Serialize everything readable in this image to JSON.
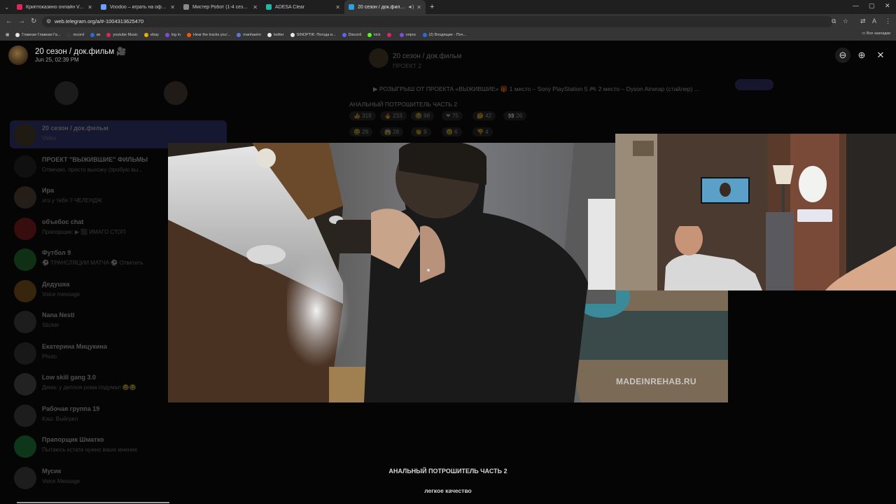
{
  "browser": {
    "tabs": [
      {
        "title": "Криптоказино онлайн VAVADA",
        "color": "#e0245e"
      },
      {
        "title": "Voodoo – играть на официальн...",
        "color": "#6aa0ff"
      },
      {
        "title": "Мистер Робот (1-4 сезон) смо...",
        "color": "#8a8a8a"
      },
      {
        "title": "ADESA Clear",
        "color": "#1fb7a6"
      },
      {
        "title": "20 сезон / док.фильм",
        "color": "#2aa3e0"
      }
    ],
    "url": "web.telegram.org/a/#-1004313625470",
    "bookmarks": [
      {
        "label": "Главная Главная Га...",
        "color": "#e8e8e8"
      },
      {
        "label": "record",
        "color": "#3b3b3b"
      },
      {
        "label": "вк",
        "color": "#2a6cd6"
      },
      {
        "label": "youtube Music",
        "color": "#e0245e"
      },
      {
        "label": "ebay",
        "color": "#e5b000"
      },
      {
        "label": "log in",
        "color": "#7b4de0"
      },
      {
        "label": "Hear the tracks you'...",
        "color": "#ff5500"
      },
      {
        "label": "manhaeim",
        "color": "#5b7bd6"
      },
      {
        "label": "twitter",
        "color": "#e8e8e8"
      },
      {
        "label": "SINOPTIK: Погода в...",
        "color": "#e8e8e8"
      },
      {
        "label": "Discord",
        "color": "#5865f2"
      },
      {
        "label": "kick",
        "color": "#53fc18"
      },
      {
        "label": "",
        "color": "#e0245e"
      },
      {
        "label": "опрос",
        "color": "#7b4de0"
      },
      {
        "label": "(2) Входящие - Поч...",
        "color": "#2a6cd6"
      }
    ],
    "all_bookmarks": "Все закладки"
  },
  "viewer": {
    "title": "20 сезон / док.фильм 🎥",
    "date": "Jun 25, 02:39 PM",
    "caption_title": "АНАЛЬНЫЙ ПОТРОШИТЕЛЬ ЧАСТЬ 2",
    "caption_quality": "легкое качество",
    "watermark": "MADEINREHAB.RU",
    "progress": 0.17
  },
  "background": {
    "chats": [
      {
        "name": "20 сезон / док.фильм",
        "preview": "Video",
        "color": "#5a4a30",
        "selected": true
      },
      {
        "name": "ПРОЕКТ \"ВЫЖИВШИЕ\" ФИЛЬМЫ",
        "preview": "Отвечаю, просто выхожу (пробую вы...",
        "color": "#2a2a2a",
        "selected": false
      },
      {
        "name": "Ира",
        "preview": "это у тебя ? ЧЕЛЕНДЖ",
        "color": "#6a5040",
        "selected": false
      },
      {
        "name": "объебос chat",
        "preview": "Прапорщик: ▶ ⬛ ИМАГО СТОП",
        "color": "#a02020",
        "selected": false
      },
      {
        "name": "Футбол 9",
        "preview": "⚽ ТРАНСЛЯЦИИ МАТЧА ⚽ Ответить",
        "color": "#2a8a3a",
        "selected": false
      },
      {
        "name": "Дедушка",
        "preview": "Voice message",
        "color": "#a06a20",
        "selected": false
      },
      {
        "name": "Nana Nesti",
        "preview": "Sticker",
        "color": "#505050",
        "selected": false
      },
      {
        "name": "Екатерина Мицукина",
        "preview": "Photo",
        "color": "#404040",
        "selected": false
      },
      {
        "name": "Low skill gang 3.0",
        "preview": "Дима: у деплоя рома подумал 😂😂",
        "color": "#606060",
        "selected": false
      },
      {
        "name": "Рабочая группа 19",
        "preview": "Кэш: Выйгрел",
        "color": "#505050",
        "selected": false
      },
      {
        "name": "Прапорщик Шматко",
        "preview": "Пытаюсь кстати нужно ваше мнение",
        "color": "#20a040",
        "selected": false
      },
      {
        "name": "Мусик",
        "preview": "Voice Message",
        "color": "#505050",
        "selected": false
      }
    ],
    "pinned_title": "20 сезон / док.фильм",
    "pinned_sub": "ПРОЕКТ 2",
    "post_text": "▶ РОЗЫГРЫШ ОТ ПРОЕКТА «ВЫЖИВШИЕ» 🎁 1 место – Sony PlayStation 5 🎮 2 место – Dyson Airwrap (стайлер) ...",
    "post_heading": "АНАЛЬНЫЙ ПОТРОШИТЕЛЬ ЧАСТЬ 2",
    "reactions_row1": [
      "👍 319",
      "🔥 233",
      "😂 98",
      "❤ 75",
      "🤔 42",
      "👀 26"
    ],
    "reactions_row2": [
      "🤮 29",
      "😱 28",
      "👏 9",
      "😢 6",
      "👎 4"
    ]
  }
}
